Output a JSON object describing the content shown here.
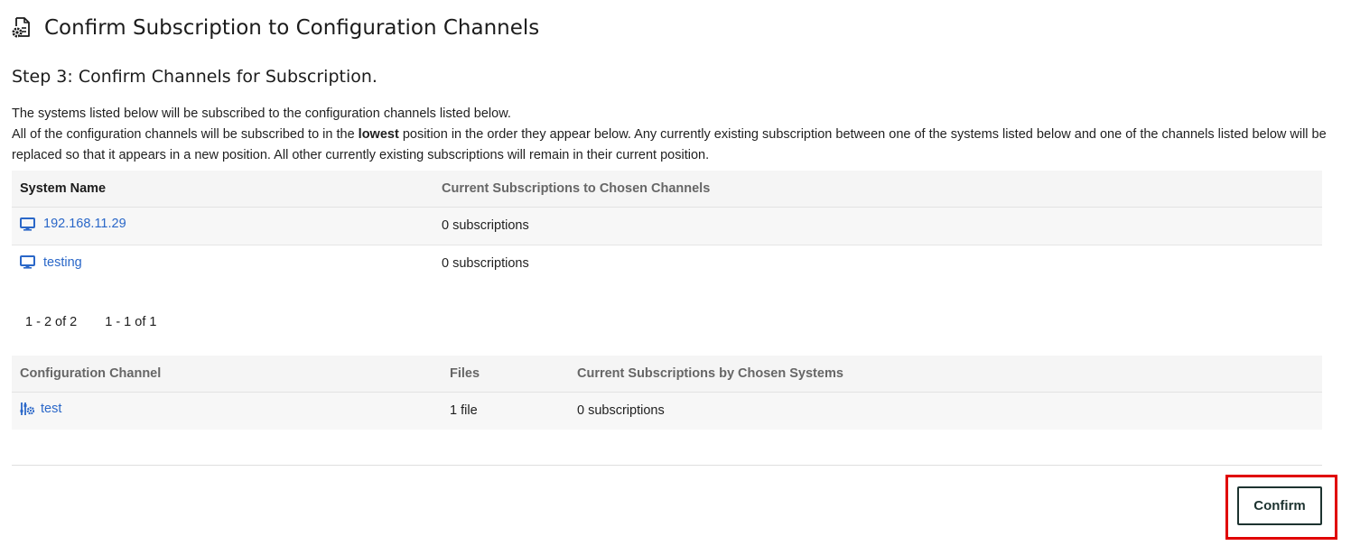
{
  "header": {
    "title": "Confirm Subscription to Configuration Channels",
    "icon": "config-file-gear-icon"
  },
  "step": {
    "title": "Step 3: Confirm Channels for Subscription."
  },
  "description": {
    "line1": "The systems listed below will be subscribed to the configuration channels listed below.",
    "line2_before": "All of the configuration channels will be subscribed to in the ",
    "line2_bold": "lowest",
    "line2_after": " position in the order they appear below. Any currently existing subscription between one of the systems listed below and one of the channels listed below will be replaced so that it appears in a new position. All other currently existing subscriptions will remain in their current position."
  },
  "systems_table": {
    "columns": [
      "System Name",
      "Current Subscriptions to Chosen Channels"
    ],
    "rows": [
      {
        "name": "192.168.11.29",
        "subscriptions": "0 subscriptions",
        "icon": "desktop-icon"
      },
      {
        "name": "testing",
        "subscriptions": "0 subscriptions",
        "icon": "desktop-icon"
      }
    ]
  },
  "pager": {
    "systems_range": "1 - 2 of 2",
    "pages_range": "1 - 1 of 1"
  },
  "channels_table": {
    "columns": [
      "Configuration Channel",
      "Files",
      "Current Subscriptions by Chosen Systems"
    ],
    "rows": [
      {
        "name": "test",
        "files": "1 file",
        "subscriptions": "0 subscriptions",
        "icon": "config-channel-icon"
      }
    ]
  },
  "actions": {
    "confirm_label": "Confirm"
  },
  "colors": {
    "link": "#2a67c8",
    "highlight": "#e00000",
    "button_border": "#1d3330"
  }
}
